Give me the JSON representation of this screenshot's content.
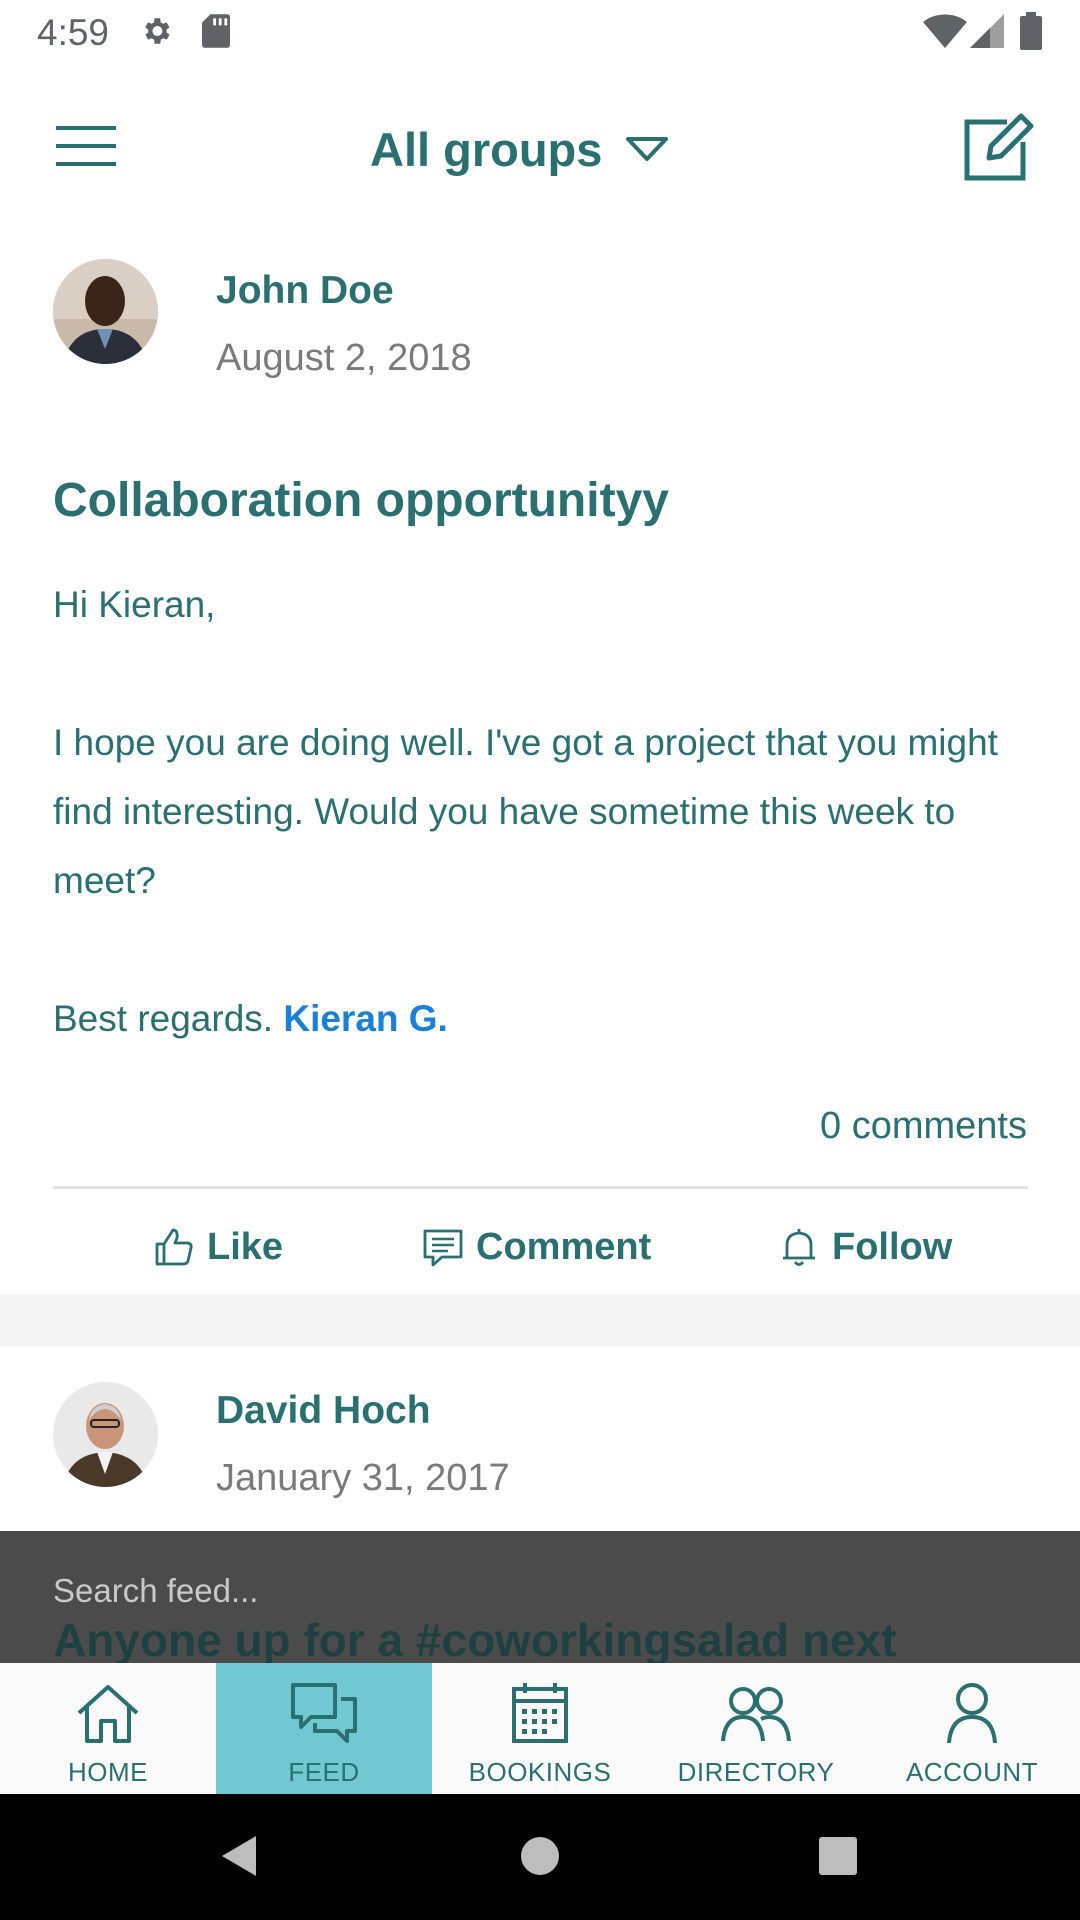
{
  "status_bar": {
    "time": "4:59",
    "icons": [
      "settings-gear-icon",
      "sd-card-icon",
      "wifi-icon",
      "cell-signal-icon",
      "battery-icon"
    ]
  },
  "app_bar": {
    "title": "All groups",
    "menu_icon": "hamburger-menu-icon",
    "dropdown_icon": "caret-down-icon",
    "compose_icon": "compose-edit-icon"
  },
  "feed": {
    "posts": [
      {
        "author": "John Doe",
        "date": "August 2, 2018",
        "title": "Collaboration opportunityy",
        "greeting": "Hi Kieran,",
        "body": "I hope you are doing well. I've got a project that you might find interesting. Would you have sometime this week to meet?",
        "signoff": "Best regards.",
        "mention": "Kieran G.",
        "comments": "0 comments",
        "actions": {
          "like": "Like",
          "comment": "Comment",
          "follow": "Follow"
        }
      },
      {
        "author": "David Hoch",
        "date": "January 31, 2017",
        "title": "Anyone up for a #coworkingsalad next"
      }
    ]
  },
  "search": {
    "placeholder": "Search feed..."
  },
  "bottom_nav": {
    "items": [
      {
        "label": "HOME",
        "icon": "home-icon"
      },
      {
        "label": "FEED",
        "icon": "chat-bubbles-icon"
      },
      {
        "label": "BOOKINGS",
        "icon": "calendar-icon"
      },
      {
        "label": "DIRECTORY",
        "icon": "people-icon"
      },
      {
        "label": "ACCOUNT",
        "icon": "person-icon"
      }
    ],
    "active": "FEED"
  },
  "colors": {
    "primary": "#2a7071",
    "active_tab": "#72c8d2",
    "mention": "#1a7fd8",
    "muted": "#7a7a7a"
  }
}
